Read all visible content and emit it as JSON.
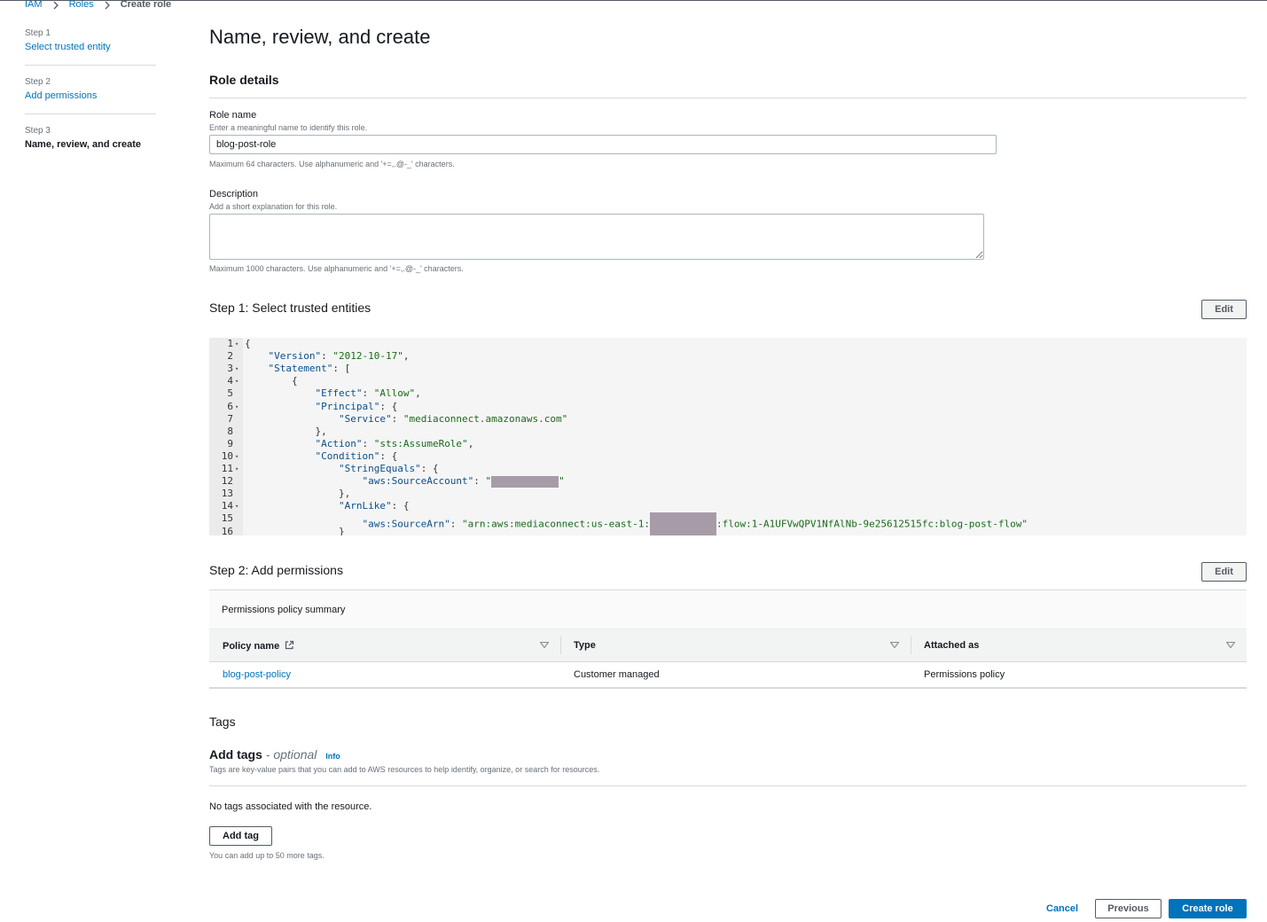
{
  "breadcrumb": {
    "items": [
      "IAM",
      "Roles"
    ],
    "current": "Create role"
  },
  "sidenav": {
    "steps": [
      {
        "num": "Step 1",
        "label": "Select trusted entity"
      },
      {
        "num": "Step 2",
        "label": "Add permissions"
      },
      {
        "num": "Step 3",
        "label": "Name, review, and create"
      }
    ]
  },
  "page": {
    "title": "Name, review, and create"
  },
  "role_details": {
    "heading": "Role details",
    "role_name": {
      "label": "Role name",
      "hint": "Enter a meaningful name to identify this role.",
      "value": "blog-post-role",
      "constraint": "Maximum 64 characters. Use alphanumeric and '+=,.@-_' characters."
    },
    "description": {
      "label": "Description",
      "hint": "Add a short explanation for this role.",
      "value": "",
      "constraint": "Maximum 1000 characters. Use alphanumeric and '+=,.@-_' characters."
    }
  },
  "step1": {
    "heading": "Step 1: Select trusted entities",
    "edit_label": "Edit",
    "code_lines": [
      {
        "n": "1",
        "fold": true,
        "parts": [
          {
            "t": "p",
            "v": "{"
          }
        ]
      },
      {
        "n": "2",
        "fold": false,
        "parts": [
          {
            "t": "p",
            "v": "    "
          },
          {
            "t": "k",
            "v": "\"Version\""
          },
          {
            "t": "p",
            "v": ": "
          },
          {
            "t": "s",
            "v": "\"2012-10-17\""
          },
          {
            "t": "p",
            "v": ","
          }
        ]
      },
      {
        "n": "3",
        "fold": true,
        "parts": [
          {
            "t": "p",
            "v": "    "
          },
          {
            "t": "k",
            "v": "\"Statement\""
          },
          {
            "t": "p",
            "v": ": ["
          }
        ]
      },
      {
        "n": "4",
        "fold": true,
        "parts": [
          {
            "t": "p",
            "v": "        {"
          }
        ]
      },
      {
        "n": "5",
        "fold": false,
        "parts": [
          {
            "t": "p",
            "v": "            "
          },
          {
            "t": "k",
            "v": "\"Effect\""
          },
          {
            "t": "p",
            "v": ": "
          },
          {
            "t": "s",
            "v": "\"Allow\""
          },
          {
            "t": "p",
            "v": ","
          }
        ]
      },
      {
        "n": "6",
        "fold": true,
        "parts": [
          {
            "t": "p",
            "v": "            "
          },
          {
            "t": "k",
            "v": "\"Principal\""
          },
          {
            "t": "p",
            "v": ": {"
          }
        ]
      },
      {
        "n": "7",
        "fold": false,
        "parts": [
          {
            "t": "p",
            "v": "                "
          },
          {
            "t": "k",
            "v": "\"Service\""
          },
          {
            "t": "p",
            "v": ": "
          },
          {
            "t": "s",
            "v": "\"mediaconnect.amazonaws.com\""
          }
        ]
      },
      {
        "n": "8",
        "fold": false,
        "parts": [
          {
            "t": "p",
            "v": "            },"
          }
        ]
      },
      {
        "n": "9",
        "fold": false,
        "parts": [
          {
            "t": "p",
            "v": "            "
          },
          {
            "t": "k",
            "v": "\"Action\""
          },
          {
            "t": "p",
            "v": ": "
          },
          {
            "t": "s",
            "v": "\"sts:AssumeRole\""
          },
          {
            "t": "p",
            "v": ","
          }
        ]
      },
      {
        "n": "10",
        "fold": true,
        "parts": [
          {
            "t": "p",
            "v": "            "
          },
          {
            "t": "k",
            "v": "\"Condition\""
          },
          {
            "t": "p",
            "v": ": {"
          }
        ]
      },
      {
        "n": "11",
        "fold": true,
        "parts": [
          {
            "t": "p",
            "v": "                "
          },
          {
            "t": "k",
            "v": "\"StringEquals\""
          },
          {
            "t": "p",
            "v": ": {"
          }
        ]
      },
      {
        "n": "12",
        "fold": false,
        "parts": [
          {
            "t": "p",
            "v": "                    "
          },
          {
            "t": "k",
            "v": "\"aws:SourceAccount\""
          },
          {
            "t": "p",
            "v": ": "
          },
          {
            "t": "s",
            "v": "\""
          },
          {
            "t": "r",
            "v": "76"
          },
          {
            "t": "s",
            "v": "\""
          }
        ]
      },
      {
        "n": "13",
        "fold": false,
        "parts": [
          {
            "t": "p",
            "v": "                },"
          }
        ]
      },
      {
        "n": "14",
        "fold": true,
        "parts": [
          {
            "t": "p",
            "v": "                "
          },
          {
            "t": "k",
            "v": "\"ArnLike\""
          },
          {
            "t": "p",
            "v": ": {"
          }
        ]
      },
      {
        "n": "15",
        "fold": false,
        "parts": [
          {
            "t": "p",
            "v": "                    "
          },
          {
            "t": "k",
            "v": "\"aws:SourceArn\""
          },
          {
            "t": "p",
            "v": ": "
          },
          {
            "t": "s",
            "v": "\"arn:aws:mediaconnect:us-east-1:"
          },
          {
            "t": "r2",
            "v": "75"
          },
          {
            "t": "s",
            "v": ":flow:1-A1UFVwQPV1NfAlNb-9e25612515fc:blog-post-flow\""
          }
        ]
      },
      {
        "n": "16",
        "fold": false,
        "parts": [
          {
            "t": "p",
            "v": "                }"
          }
        ]
      }
    ]
  },
  "step2": {
    "heading": "Step 2: Add permissions",
    "edit_label": "Edit",
    "summary_title": "Permissions policy summary",
    "columns": [
      "Policy name",
      "Type",
      "Attached as"
    ],
    "rows": [
      {
        "policy_name": "blog-post-policy",
        "type": "Customer managed",
        "attached_as": "Permissions policy"
      }
    ]
  },
  "tags": {
    "heading": "Tags",
    "add_title": "Add tags",
    "optional": "- optional",
    "info": "Info",
    "description": "Tags are key-value pairs that you can add to AWS resources to help identify, organize, or search for resources.",
    "empty": "No tags associated with the resource.",
    "add_button": "Add tag",
    "limit": "You can add up to 50 more tags."
  },
  "footer": {
    "cancel": "Cancel",
    "previous": "Previous",
    "create": "Create role"
  },
  "colors": {
    "link": "#0073bb",
    "primary": "#0073bb",
    "redaction": "#a89ba8"
  }
}
